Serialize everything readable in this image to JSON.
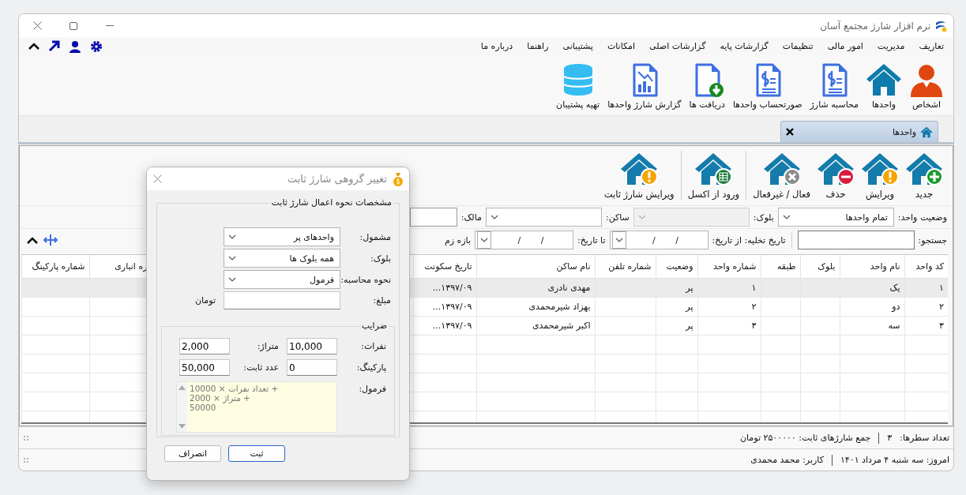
{
  "window": {
    "title": "نرم افزار شارژ مجتمع آسان"
  },
  "menu": [
    "تعاریف",
    "مدیریت",
    "امور مالی",
    "تنظیمات",
    "گزارشات پایه",
    "گزارشات اصلی",
    "امکانات",
    "پشتیبانی",
    "راهنما",
    "درباره ما"
  ],
  "ribbon": [
    {
      "label": "اشخاص",
      "kind": "person"
    },
    {
      "label": "واحدها",
      "kind": "house"
    },
    {
      "label": "محاسبه شارژ",
      "kind": "invoice"
    },
    {
      "label": "صورتحساب واحدها",
      "kind": "invoice"
    },
    {
      "label": "دریافت ها",
      "kind": "download"
    },
    {
      "label": "گزارش شارژ واحدها",
      "kind": "chart"
    },
    {
      "label": "تهیه پشتیبان",
      "kind": "database"
    }
  ],
  "tabs": [
    {
      "label": "واحدها",
      "selected": true
    }
  ],
  "toolbar": [
    [
      {
        "label": "جدید",
        "kind": "add"
      },
      {
        "label": "ویرایش",
        "kind": "edit"
      },
      {
        "label": "حذف",
        "kind": "delete"
      },
      {
        "label": "فعال / غیرفعال",
        "kind": "toggle"
      }
    ],
    [
      {
        "label": "ورود از اکسل",
        "kind": "import"
      }
    ],
    [
      {
        "label": "ویرایش شارژ ثابت",
        "kind": "edit"
      }
    ]
  ],
  "filter_rows": [
    [
      {
        "kind": "label",
        "text": "وضعیت واحد:"
      },
      {
        "kind": "select",
        "value": "تمام واحدها",
        "disabled": false
      },
      {
        "kind": "label",
        "text": "بلوک:"
      },
      {
        "kind": "select",
        "disabled": true
      },
      {
        "kind": "label",
        "text": "ساکن:"
      },
      {
        "kind": "select",
        "disabled": false
      },
      {
        "kind": "label",
        "text": "مالک:"
      },
      {
        "kind": "input"
      }
    ],
    [
      {
        "kind": "label",
        "text": "جستجو:"
      },
      {
        "kind": "search"
      },
      {
        "kind": "separator"
      },
      {
        "kind": "label",
        "text": "تاریخ تخلیه: از تاریخ:"
      },
      {
        "kind": "date",
        "value": "/ /"
      },
      {
        "kind": "label",
        "text": "تا تاریخ:"
      },
      {
        "kind": "date",
        "value": "/ /"
      },
      {
        "kind": "label",
        "text": "بازه زم"
      }
    ]
  ],
  "table": {
    "columns": [
      "کد واحد",
      "نام واحد",
      "بلوک",
      "طبقه",
      "شماره واحد",
      "وضعیت",
      "شماره تلفن",
      "نام ساکن",
      "تاریخ سکونت",
      "ره انباری",
      "شماره پارکینگ"
    ],
    "rows": [
      {
        "unit_code": "۱",
        "unit_name": "یک",
        "unit_number": "۱",
        "status": "پر",
        "resident": "مهدی نادری",
        "residence_date": "۱۳۹۷/۰۹...",
        "selected": true
      },
      {
        "unit_code": "۲",
        "unit_name": "دو",
        "unit_number": "۲",
        "status": "پر",
        "resident": "بهزاد شیرمحمدی",
        "residence_date": "۱۳۹۷/۰۹...",
        "selected": false
      },
      {
        "unit_code": "۳",
        "unit_name": "سه",
        "unit_number": "۳",
        "status": "پر",
        "resident": "اکبر شیرمحمدی",
        "residence_date": "۱۳۹۷/۰۹...",
        "selected": false
      }
    ]
  },
  "status_bar": {
    "row_count_label": "تعداد سطرها:",
    "row_count": "۳",
    "total": "جمع شارژهای ثابت: ۲۵۰۰۰۰۰ تومان"
  },
  "footer": {
    "today": "امروز: سه شنبه ۴ مرداد ۱۴۰۱",
    "user": "کاربر: محمد محمدی"
  },
  "dialog": {
    "title": "تغییر گروهی شارژ ثابت",
    "group_title": "مشخصات نحوه اعمال شارژ ثابت",
    "fields": [
      {
        "label": "مشمول:",
        "kind": "select",
        "value": "واحدهای پر"
      },
      {
        "label": "بلوک:",
        "kind": "select",
        "value": "همه بلوک ها"
      },
      {
        "label": "نحوه محاسبه:",
        "kind": "select",
        "value": "فرمول"
      },
      {
        "label": "مبلغ:",
        "kind": "input",
        "unit": "تومان"
      }
    ],
    "coefficients": {
      "title": "ضرایب",
      "fields": [
        {
          "label": "نفرات:",
          "value": "10,000"
        },
        {
          "label": "متراژ:",
          "value": "2,000"
        },
        {
          "label": "پارکینگ:",
          "value": "0"
        },
        {
          "label": "عدد ثابت:",
          "value": "50,000"
        }
      ],
      "formula": {
        "label": "فرمول:",
        "lines": [
          "+ تعداد نفرات × 10000",
          "+ متراژ × 2000",
          "50000"
        ]
      }
    },
    "buttons": [
      {
        "label": "ثبت",
        "focused": true
      },
      {
        "label": "انصراف",
        "focused": false
      }
    ]
  }
}
